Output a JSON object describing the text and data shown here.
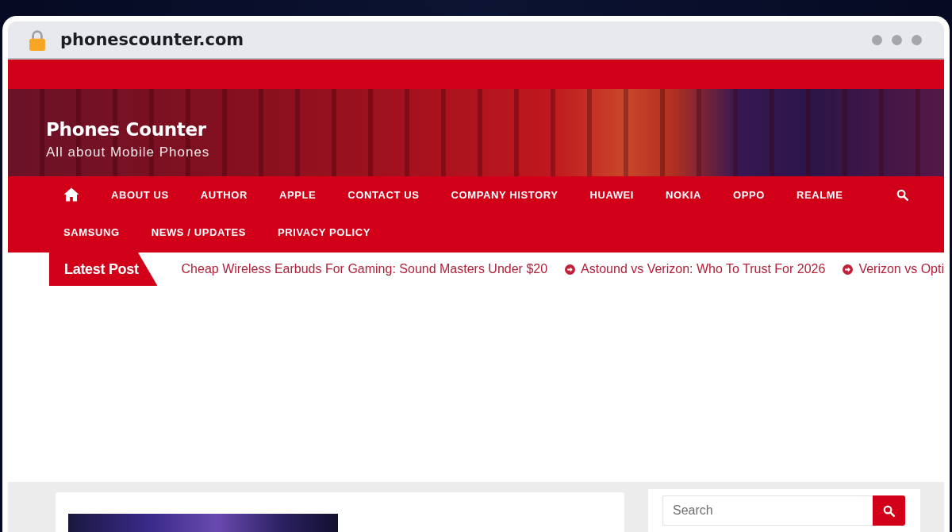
{
  "browser": {
    "url": "phonescounter.com"
  },
  "header": {
    "site_title": "Phones Counter",
    "tagline": "All about Mobile Phones"
  },
  "nav": {
    "items": [
      {
        "kind": "home"
      },
      {
        "kind": "link",
        "label": "ABOUT US"
      },
      {
        "kind": "link",
        "label": "AUTHOR"
      },
      {
        "kind": "link",
        "label": "APPLE"
      },
      {
        "kind": "link",
        "label": "CONTACT US"
      },
      {
        "kind": "link",
        "label": "COMPANY HISTORY"
      },
      {
        "kind": "link",
        "label": "HUAWEI"
      },
      {
        "kind": "link",
        "label": "NOKIA"
      },
      {
        "kind": "link",
        "label": "OPPO"
      },
      {
        "kind": "link",
        "label": "REALME"
      },
      {
        "kind": "link",
        "label": "SAMSUNG"
      },
      {
        "kind": "link",
        "label": "NEWS / UPDATES"
      },
      {
        "kind": "link",
        "label": "PRIVACY POLICY"
      }
    ]
  },
  "ticker": {
    "label": "Latest Post",
    "items": [
      "Cheap Wireless Earbuds For Gaming: Sound Masters Under $20",
      "Astound vs Verizon: Who To Trust For 2026",
      "Verizon vs Opti"
    ]
  },
  "sidebar": {
    "search": {
      "placeholder": "Search"
    }
  }
}
